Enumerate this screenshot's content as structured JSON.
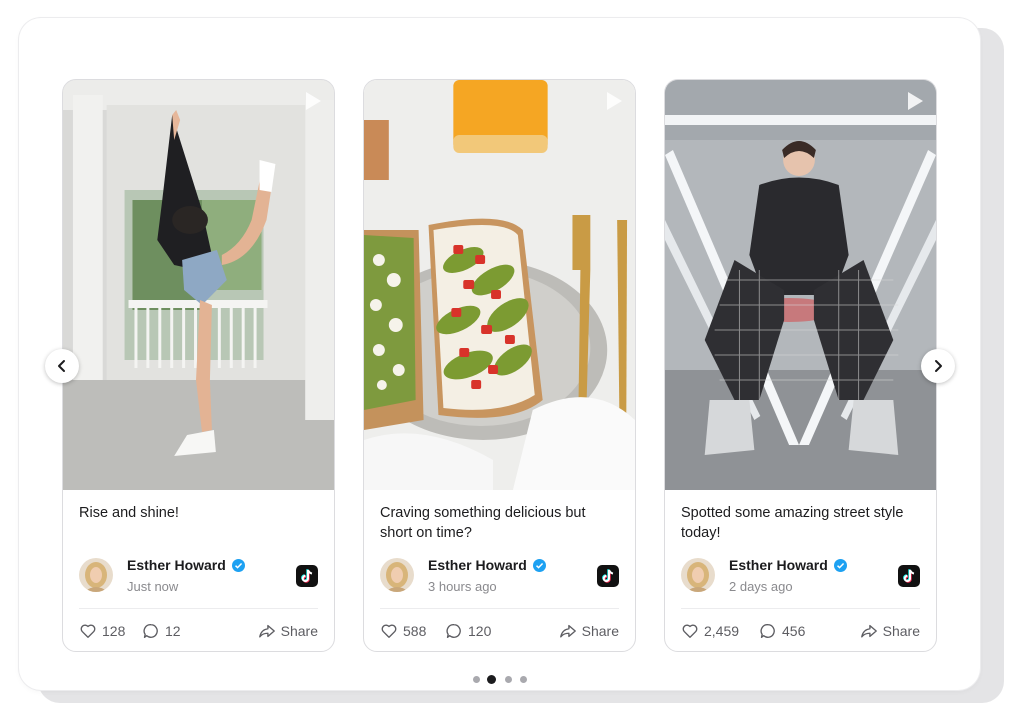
{
  "posts": [
    {
      "caption": "Rise and shine!",
      "author": "Esther Howard",
      "time": "Just now",
      "likes": "128",
      "comments": "12",
      "share_label": "Share"
    },
    {
      "caption": "Craving something delicious but short on time?",
      "author": "Esther Howard",
      "time": "3 hours ago",
      "likes": "588",
      "comments": "120",
      "share_label": "Share"
    },
    {
      "caption": "Spotted some amazing street style today!",
      "author": "Esther Howard",
      "time": "2 days ago",
      "likes": "2,459",
      "comments": "456",
      "share_label": "Share"
    }
  ],
  "carousel": {
    "active_page": 2,
    "page_count": 4
  },
  "icons": {
    "prev": "chevron-left-icon",
    "next": "chevron-right-icon",
    "play": "play-icon",
    "verified": "verified-badge-icon",
    "platform": "tiktok-icon",
    "like": "heart-icon",
    "comment": "comment-icon",
    "share": "share-icon"
  },
  "colors": {
    "verified": "#1da1f2",
    "tiktok_bg": "#111111",
    "active_dot": "#1c1c1e",
    "inactive_dot": "#a9a9ae"
  }
}
